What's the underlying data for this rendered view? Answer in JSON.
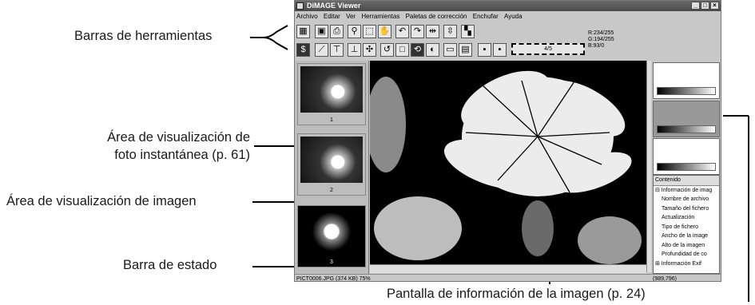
{
  "annotations": {
    "toolbars": "Barras de herramientas",
    "snapshot_area_line1": "Área de visualización de",
    "snapshot_area_line2": "foto instantánea (p. 61)",
    "image_area": "Área de visualización de imagen",
    "status_bar": "Barra de estado",
    "image_info": "Pantalla de información de la imagen (p. 24)"
  },
  "window": {
    "title": "DiMAGE Viewer",
    "controls": [
      "_",
      "□",
      "×"
    ]
  },
  "menu": [
    "Archivo",
    "Editar",
    "Ver",
    "Herramientas",
    "Paletas de corrección",
    "Enchufar",
    "Ayuda"
  ],
  "toolbar1_icons": [
    "thumbnails-icon",
    "save-icon",
    "print-icon",
    "zoom-icon",
    "select-icon",
    "hand-icon",
    "rotate-left-icon",
    "rotate-right-icon",
    "flip-horizontal-icon",
    "flip-vertical-icon",
    "convert-icon"
  ],
  "toolbar2_icons": [
    "saturation-icon",
    "tone-curve-icon",
    "levels-icon",
    "levels2-icon",
    "color-balance-icon",
    "undo-icon",
    "redo-icon",
    "reset-icon",
    "brightness-icon",
    "compare-icon",
    "split-icon",
    "snapshot-icon",
    "gallery-icon"
  ],
  "frame_counter": "4/5",
  "rgb": {
    "r": "R:234/255",
    "g": "G:194/255",
    "b": "B:93/0"
  },
  "thumbnails": [
    {
      "label": "1",
      "selected": false
    },
    {
      "label": "2",
      "selected": false
    },
    {
      "label": "3",
      "selected": true
    }
  ],
  "info_panel": {
    "header": "Contenido",
    "items": [
      "⊟ Información de imag",
      "Nombre de archivo",
      "Tamaño del fichero",
      "Actualización",
      "Tipo de fichero",
      "Ancho de la image",
      "Alto de la imagen",
      "Profundidad de co",
      "⊞ Información Exif"
    ]
  },
  "status": {
    "file": "PICT0006.JPG (374 KB) 75%",
    "coords": "(989,796)"
  }
}
